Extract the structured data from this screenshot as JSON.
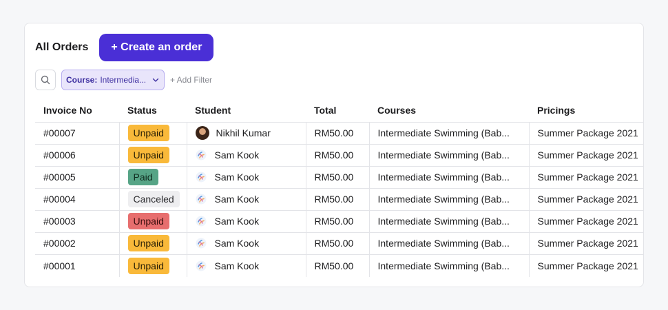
{
  "header": {
    "title": "All Orders",
    "create_label": "+ Create an order"
  },
  "filters": {
    "search_icon": "search-icon",
    "chip_key": "Course:",
    "chip_value": "Intermedia...",
    "add_filter_label": "+ Add Filter"
  },
  "table": {
    "columns": [
      "Invoice No",
      "Status",
      "Student",
      "Total",
      "Courses",
      "Pricings"
    ],
    "rows": [
      {
        "invoice": "#00007",
        "status": "Unpaid",
        "status_style": "unpaid",
        "student": "Nikhil Kumar",
        "avatar": "photo",
        "total": "RM50.00",
        "course": "Intermediate Swimming (Bab...",
        "pricing": "Summer Package 2021"
      },
      {
        "invoice": "#00006",
        "status": "Unpaid",
        "status_style": "unpaid",
        "student": "Sam Kook",
        "avatar": "logo",
        "total": "RM50.00",
        "course": "Intermediate Swimming (Bab...",
        "pricing": "Summer Package 2021"
      },
      {
        "invoice": "#00005",
        "status": "Paid",
        "status_style": "paid",
        "student": "Sam Kook",
        "avatar": "logo",
        "total": "RM50.00",
        "course": "Intermediate Swimming (Bab...",
        "pricing": "Summer Package 2021"
      },
      {
        "invoice": "#00004",
        "status": "Canceled",
        "status_style": "canceled",
        "student": "Sam Kook",
        "avatar": "logo",
        "total": "RM50.00",
        "course": "Intermediate Swimming (Bab...",
        "pricing": "Summer Package 2021"
      },
      {
        "invoice": "#00003",
        "status": "Unpaid",
        "status_style": "unpaid-red",
        "student": "Sam Kook",
        "avatar": "logo",
        "total": "RM50.00",
        "course": "Intermediate Swimming (Bab...",
        "pricing": "Summer Package 2021"
      },
      {
        "invoice": "#00002",
        "status": "Unpaid",
        "status_style": "unpaid",
        "student": "Sam Kook",
        "avatar": "logo",
        "total": "RM50.00",
        "course": "Intermediate Swimming (Bab...",
        "pricing": "Summer Package 2021"
      },
      {
        "invoice": "#00001",
        "status": "Unpaid",
        "status_style": "unpaid",
        "student": "Sam Kook",
        "avatar": "logo",
        "total": "RM50.00",
        "course": "Intermediate Swimming (Bab...",
        "pricing": "Summer Package 2021"
      }
    ]
  },
  "colors": {
    "accent": "#4a2fd6",
    "unpaid": "#f9b93a",
    "paid": "#56a486",
    "canceled": "#eeeef0",
    "unpaid_red": "#e76e6e"
  }
}
